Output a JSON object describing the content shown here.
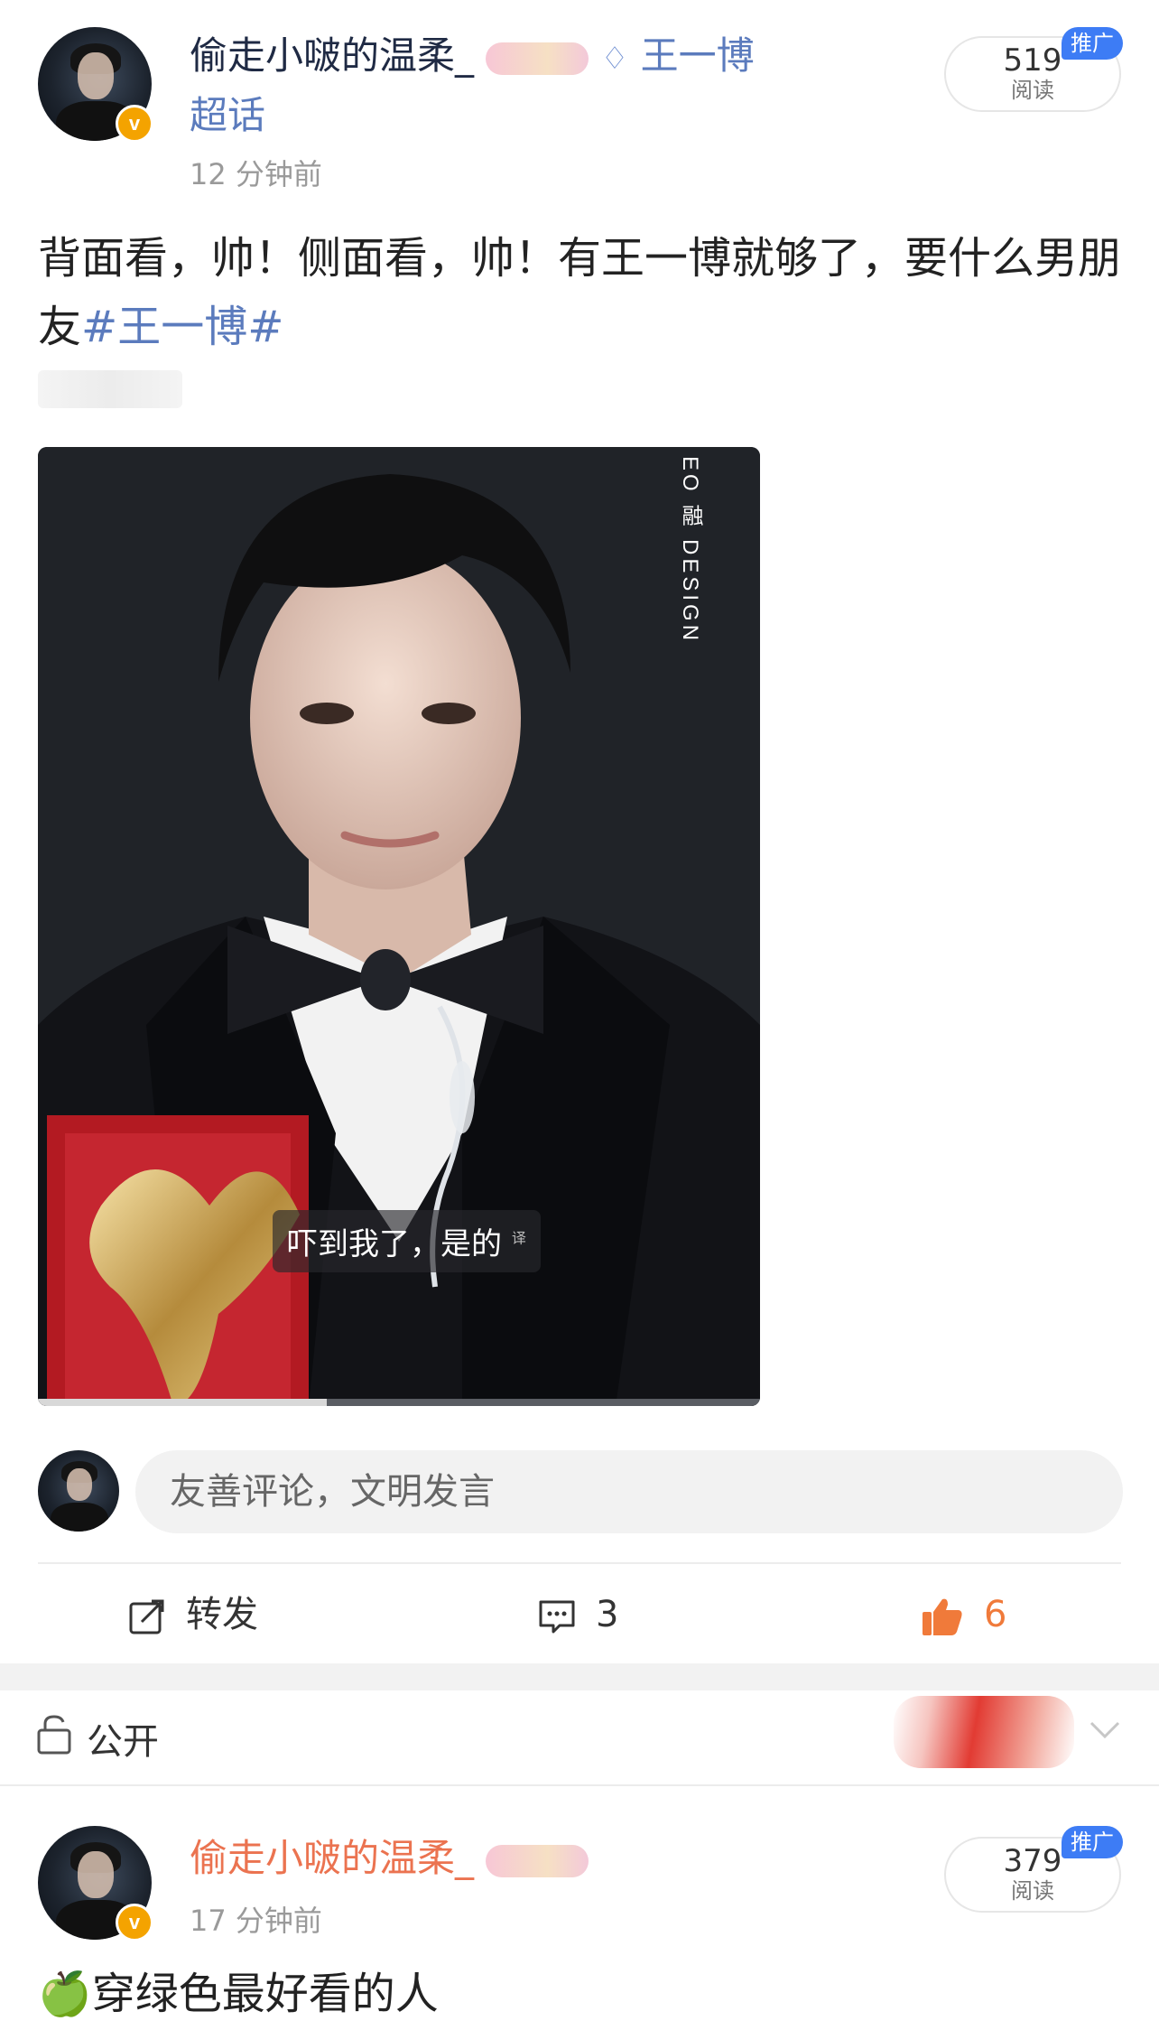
{
  "post1": {
    "username": "偷走小啵的温柔_",
    "topic_label": "王一博",
    "topic_suffix": "超话",
    "time": "12 分钟前",
    "reads_count": "519",
    "reads_label": "阅读",
    "promo_label": "推广",
    "text": "背面看，帅！侧面看，帅！有王一博就够了，要什么男朋友",
    "hashtag": "#王一博#",
    "media": {
      "watermark": "EO 融 DESIGN",
      "subtitle": "吓到我了，是的",
      "subtitle_mark": "译"
    },
    "comment_placeholder": "友善评论，文明发言",
    "actions": {
      "repost_label": "转发",
      "comments_count": "3",
      "likes_count": "6"
    }
  },
  "visibility_bar": {
    "label": "公开"
  },
  "post2": {
    "username": "偷走小啵的温柔_",
    "time": "17 分钟前",
    "reads_count": "379",
    "reads_label": "阅读",
    "promo_label": "推广",
    "emoji": "🍏",
    "text": "穿绿色最好看的人"
  },
  "colors": {
    "link": "#5b7bbd",
    "username_orange": "#eb7350",
    "like_orange": "#f07a3a",
    "verified_badge": "#f4a300",
    "promo_blue": "#3d7cf5"
  },
  "icons": [
    "lock-icon",
    "repost-icon",
    "comment-icon",
    "like-icon",
    "chevron-down-icon",
    "diamond-icon",
    "verified-icon"
  ]
}
